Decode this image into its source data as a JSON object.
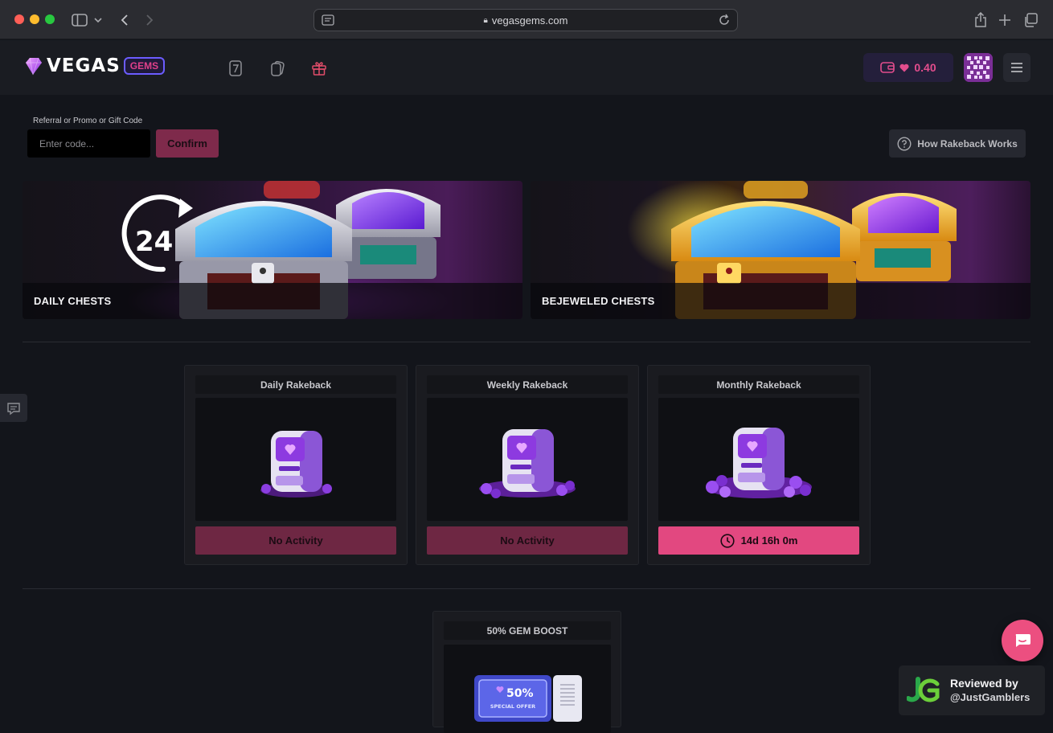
{
  "browser": {
    "url": "vegasgems.com"
  },
  "header": {
    "logo_text": "VEGAS",
    "logo_badge": "GEMS",
    "nav_icons": [
      "slots-7-icon",
      "cards-icon",
      "gift-icon"
    ],
    "wallet_balance": "0.40",
    "accent_color": "#e24d8d"
  },
  "promo": {
    "label": "Referral or Promo or Gift Code",
    "placeholder": "Enter code...",
    "confirm_label": "Confirm",
    "how_rakeback_label": "How Rakeback Works"
  },
  "banners": [
    {
      "title": "DAILY CHESTS",
      "badge": "24"
    },
    {
      "title": "BEJEWELED CHESTS"
    }
  ],
  "rakeback": [
    {
      "title": "Daily Rakeback",
      "status": "No Activity",
      "active": false
    },
    {
      "title": "Weekly Rakeback",
      "status": "No Activity",
      "active": false
    },
    {
      "title": "Monthly Rakeback",
      "status": "14d 16h 0m",
      "active": true
    }
  ],
  "boost": {
    "title": "50% GEM BOOST",
    "ticket_text": "50%",
    "ticket_sub": "SPECIAL OFFER"
  },
  "reviewed": {
    "line1": "Reviewed by",
    "line2": "@JustGamblers"
  }
}
